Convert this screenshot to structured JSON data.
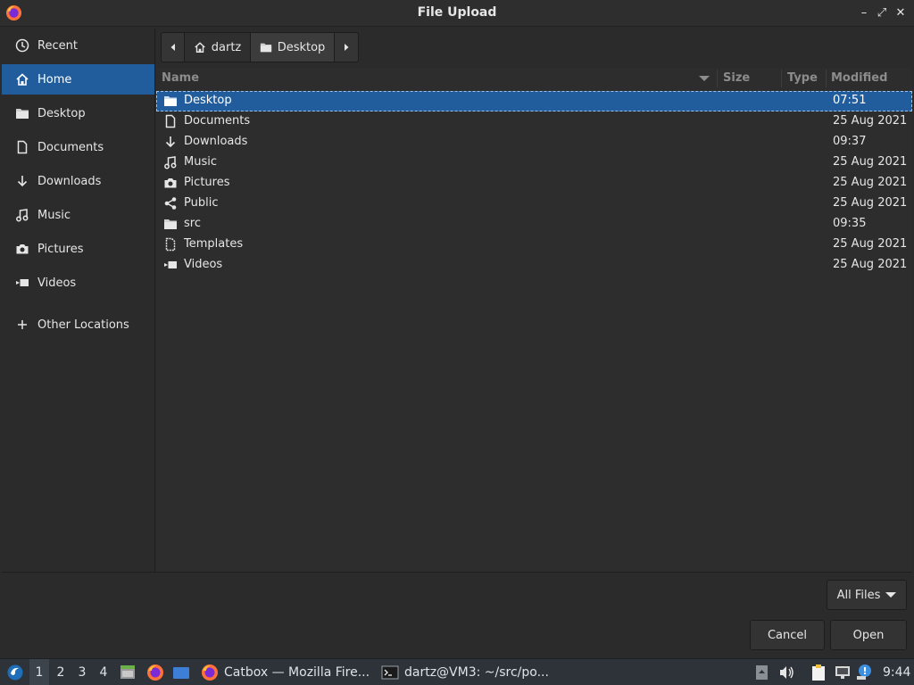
{
  "window": {
    "title": "File Upload",
    "minimize_glyph": "–",
    "restore_glyph": "⤢",
    "close_glyph": "✕"
  },
  "sidebar": {
    "items": [
      {
        "label": "Recent",
        "icon": "clock-icon"
      },
      {
        "label": "Home",
        "icon": "home-icon",
        "active": true
      },
      {
        "label": "Desktop",
        "icon": "folder-icon"
      },
      {
        "label": "Documents",
        "icon": "document-icon"
      },
      {
        "label": "Downloads",
        "icon": "download-icon"
      },
      {
        "label": "Music",
        "icon": "music-icon"
      },
      {
        "label": "Pictures",
        "icon": "camera-icon"
      },
      {
        "label": "Videos",
        "icon": "video-icon"
      },
      {
        "label": "Other Locations",
        "icon": "plus-icon"
      }
    ]
  },
  "pathbar": {
    "segments": [
      {
        "label": "dartz",
        "icon": "home-icon"
      },
      {
        "label": "Desktop",
        "icon": "folder-icon"
      }
    ]
  },
  "filelist": {
    "columns": [
      "Name",
      "Size",
      "Type",
      "Modified"
    ],
    "rows": [
      {
        "name": "Desktop",
        "modified": "07:51",
        "icon": "folder-icon",
        "selected": true
      },
      {
        "name": "Documents",
        "modified": "25 Aug 2021",
        "icon": "document-icon"
      },
      {
        "name": "Downloads",
        "modified": "09:37",
        "icon": "download-icon"
      },
      {
        "name": "Music",
        "modified": "25 Aug 2021",
        "icon": "music-icon"
      },
      {
        "name": "Pictures",
        "modified": "25 Aug 2021",
        "icon": "camera-icon"
      },
      {
        "name": "Public",
        "modified": "25 Aug 2021",
        "icon": "share-icon"
      },
      {
        "name": "src",
        "modified": "09:35",
        "icon": "folder-icon"
      },
      {
        "name": "Templates",
        "modified": "25 Aug 2021",
        "icon": "template-icon"
      },
      {
        "name": "Videos",
        "modified": "25 Aug 2021",
        "icon": "video-icon"
      }
    ]
  },
  "footer": {
    "filter_label": "All Files",
    "cancel_label": "Cancel",
    "open_label": "Open"
  },
  "taskbar": {
    "workspaces": [
      "1",
      "2",
      "3",
      "4"
    ],
    "active_workspace": "1",
    "tasks": [
      {
        "label": "Catbox — Mozilla Fire...",
        "icon": "firefox-icon"
      },
      {
        "label": "dartz@VM3: ~/src/po...",
        "icon": "terminal-icon"
      }
    ],
    "clock": "9:44"
  }
}
